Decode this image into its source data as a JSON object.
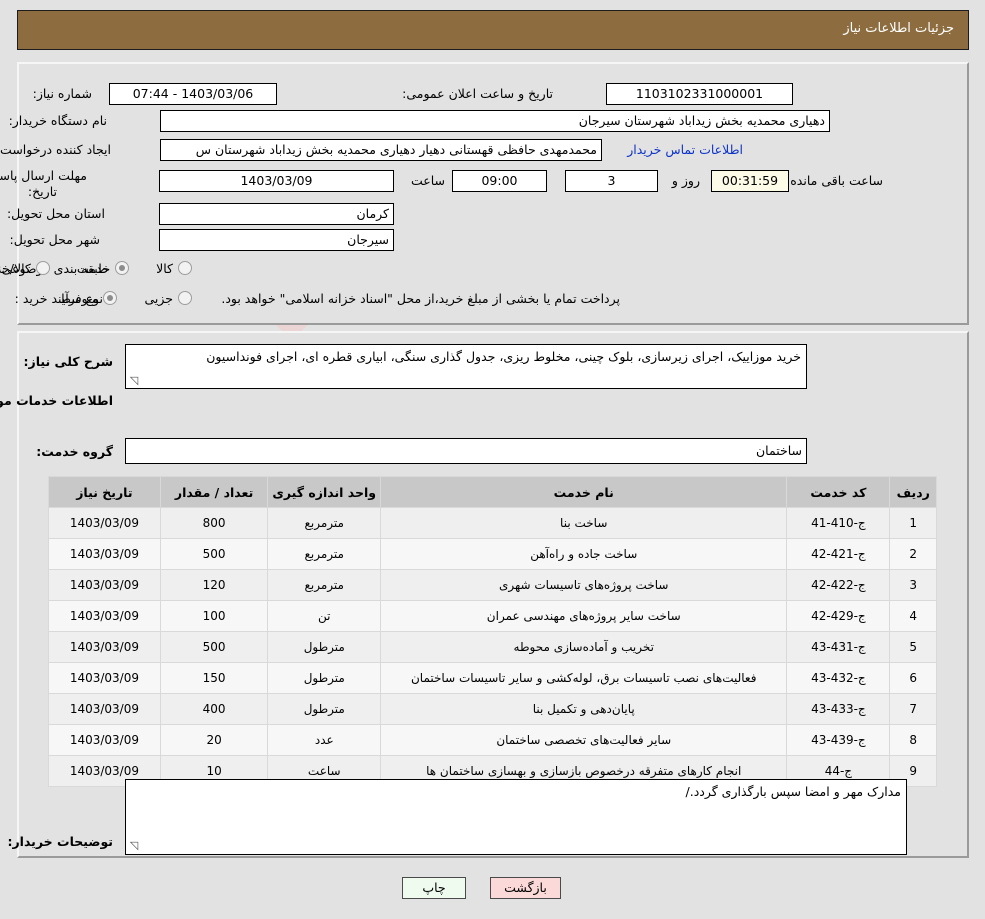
{
  "header": {
    "title": "جزئیات اطلاعات نیاز"
  },
  "watermark": {
    "text": "AriaTender.net"
  },
  "form": {
    "need_number_label": "شماره نیاز:",
    "need_number_value": "1103102331000001",
    "announce_label": "تاریخ و ساعت اعلان عمومی:",
    "announce_value": "1403/03/06 - 07:44",
    "buyer_org_label": "نام دستگاه خریدار:",
    "buyer_org_value": "دهیاری محمدیه بخش زیداباد شهرستان سیرجان",
    "creator_label": "ایجاد کننده درخواست:",
    "creator_value": "محمدمهدی حافظی قهستانی دهیار دهیاری محمدیه بخش زیداباد شهرستان س",
    "contact_link": "اطلاعات تماس خریدار",
    "deadline_label": "مهلت ارسال پاسخ: تا تاریخ:",
    "deadline_date": "1403/03/09",
    "hour_label": "ساعت",
    "deadline_time": "09:00",
    "days_value": "3",
    "days_label": "روز و",
    "countdown": "00:31:59",
    "countdown_label": "ساعت باقی مانده",
    "province_label": "استان محل تحویل:",
    "province_value": "کرمان",
    "city_label": "شهر محل تحویل:",
    "city_value": "سیرجان",
    "category_label": "طبقه بندی موضوعی:",
    "category_options": [
      {
        "label": "کالا",
        "selected": false
      },
      {
        "label": "خدمت",
        "selected": true
      },
      {
        "label": "کالا/خدمت",
        "selected": false
      }
    ],
    "process_label": "نوع فرآیند خرید :",
    "process_options": [
      {
        "label": "جزیی",
        "selected": false
      },
      {
        "label": "متوسط",
        "selected": true
      }
    ],
    "process_note": "پرداخت تمام یا بخشی از مبلغ خرید،از محل \"اسناد خزانه اسلامی\" خواهد بود.",
    "summary_label": "شرح کلی نیاز:",
    "summary_value": "خرید موزاییک، اجرای زیرسازی، بلوک چینی، مخلوط ریزی، جدول گذاری سنگی، ابیاری قطره ای، اجرای فونداسیون",
    "services_info_heading": "اطلاعات خدمات مورد نیاز",
    "service_group_label": "گروه خدمت:",
    "service_group_value": "ساختمان",
    "buyer_notes_label": "توضیحات خریدار:",
    "buyer_notes_value": "مدارک مهر و امضا سپس بارگذاری گردد./"
  },
  "table": {
    "columns": [
      "ردیف",
      "کد خدمت",
      "نام خدمت",
      "واحد اندازه گیری",
      "تعداد / مقدار",
      "تاریخ نیاز"
    ],
    "rows": [
      {
        "radif": "1",
        "code": "ج-410-41",
        "name": "ساخت بنا",
        "unit": "مترمربع",
        "qty": "800",
        "date": "1403/03/09"
      },
      {
        "radif": "2",
        "code": "ج-421-42",
        "name": "ساخت جاده و راه‌آهن",
        "unit": "مترمربع",
        "qty": "500",
        "date": "1403/03/09"
      },
      {
        "radif": "3",
        "code": "ج-422-42",
        "name": "ساخت پروژه‌های تاسیسات شهری",
        "unit": "مترمربع",
        "qty": "120",
        "date": "1403/03/09"
      },
      {
        "radif": "4",
        "code": "ج-429-42",
        "name": "ساخت سایر پروژه‌های مهندسی عمران",
        "unit": "تن",
        "qty": "100",
        "date": "1403/03/09"
      },
      {
        "radif": "5",
        "code": "ج-431-43",
        "name": "تخریب و آماده‌سازی محوطه",
        "unit": "مترطول",
        "qty": "500",
        "date": "1403/03/09"
      },
      {
        "radif": "6",
        "code": "ج-432-43",
        "name": "فعالیت‌های نصب تاسیسات برق، لوله‌کشی و سایر تاسیسات ساختمان",
        "unit": "مترطول",
        "qty": "150",
        "date": "1403/03/09"
      },
      {
        "radif": "7",
        "code": "ج-433-43",
        "name": "پایان‌دهی و تکمیل بنا",
        "unit": "مترطول",
        "qty": "400",
        "date": "1403/03/09"
      },
      {
        "radif": "8",
        "code": "ج-439-43",
        "name": "سایر فعالیت‌های تخصصی ساختمان",
        "unit": "عدد",
        "qty": "20",
        "date": "1403/03/09"
      },
      {
        "radif": "9",
        "code": "ج-44",
        "name": "انجام کارهای متفرقه درخصوص بازسازی و بهسازی ساختمان ها",
        "unit": "ساعت",
        "qty": "10",
        "date": "1403/03/09"
      }
    ]
  },
  "buttons": {
    "print": "چاپ",
    "back": "بازگشت"
  },
  "colors": {
    "header_bar": "#8d6d3f",
    "page_bg": "#e2e2e2",
    "link": "#0d34c8",
    "table_header": "#c8c8c8",
    "print_btn": "#eefbee",
    "back_btn": "#fbd9d9",
    "timer_bg": "#fbfbe8"
  }
}
